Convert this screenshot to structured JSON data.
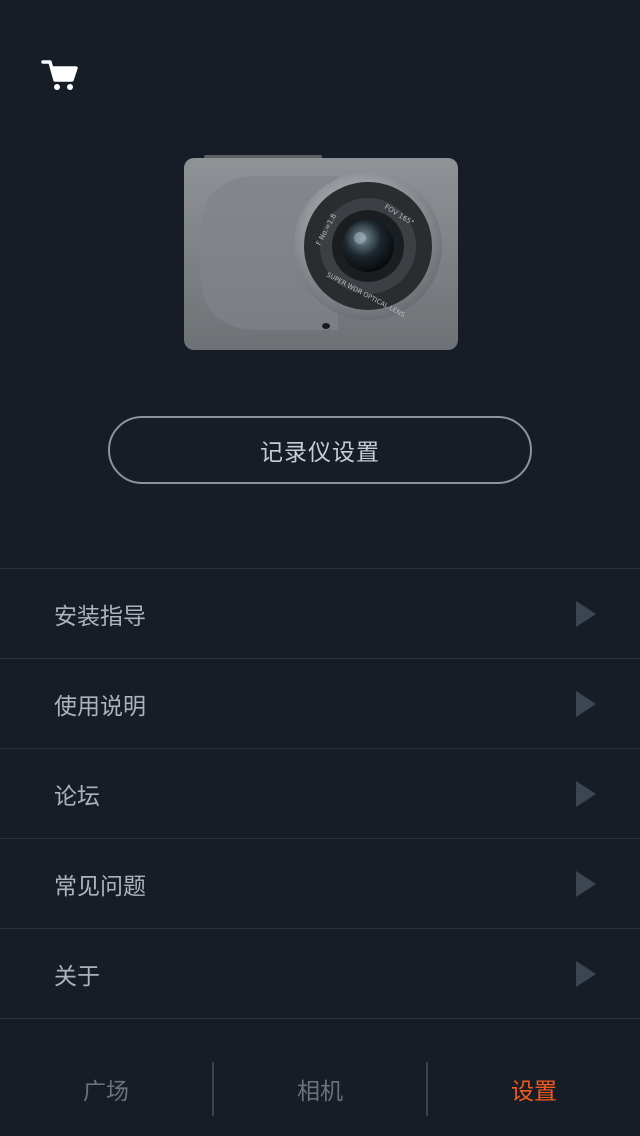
{
  "header": {
    "cart_icon": "cart-icon"
  },
  "device": {
    "button_label": "记录仪设置",
    "lens_text_left": "F No.=1.8",
    "lens_text_right": "FOV 165°",
    "lens_text_bottom": "SUPER WDR OPTICAL LENS"
  },
  "menu": {
    "items": [
      {
        "label": "安装指导",
        "icon": "chevron-right-icon"
      },
      {
        "label": "使用说明",
        "icon": "chevron-right-icon"
      },
      {
        "label": "论坛",
        "icon": "chevron-right-icon"
      },
      {
        "label": "常见问题",
        "icon": "chevron-right-icon"
      },
      {
        "label": "关于",
        "icon": "chevron-right-icon"
      }
    ]
  },
  "tabs": [
    {
      "label": "广场",
      "active": false
    },
    {
      "label": "相机",
      "active": false
    },
    {
      "label": "设置",
      "active": true
    }
  ],
  "colors": {
    "background": "#161d26",
    "accent": "#f25a1d"
  }
}
